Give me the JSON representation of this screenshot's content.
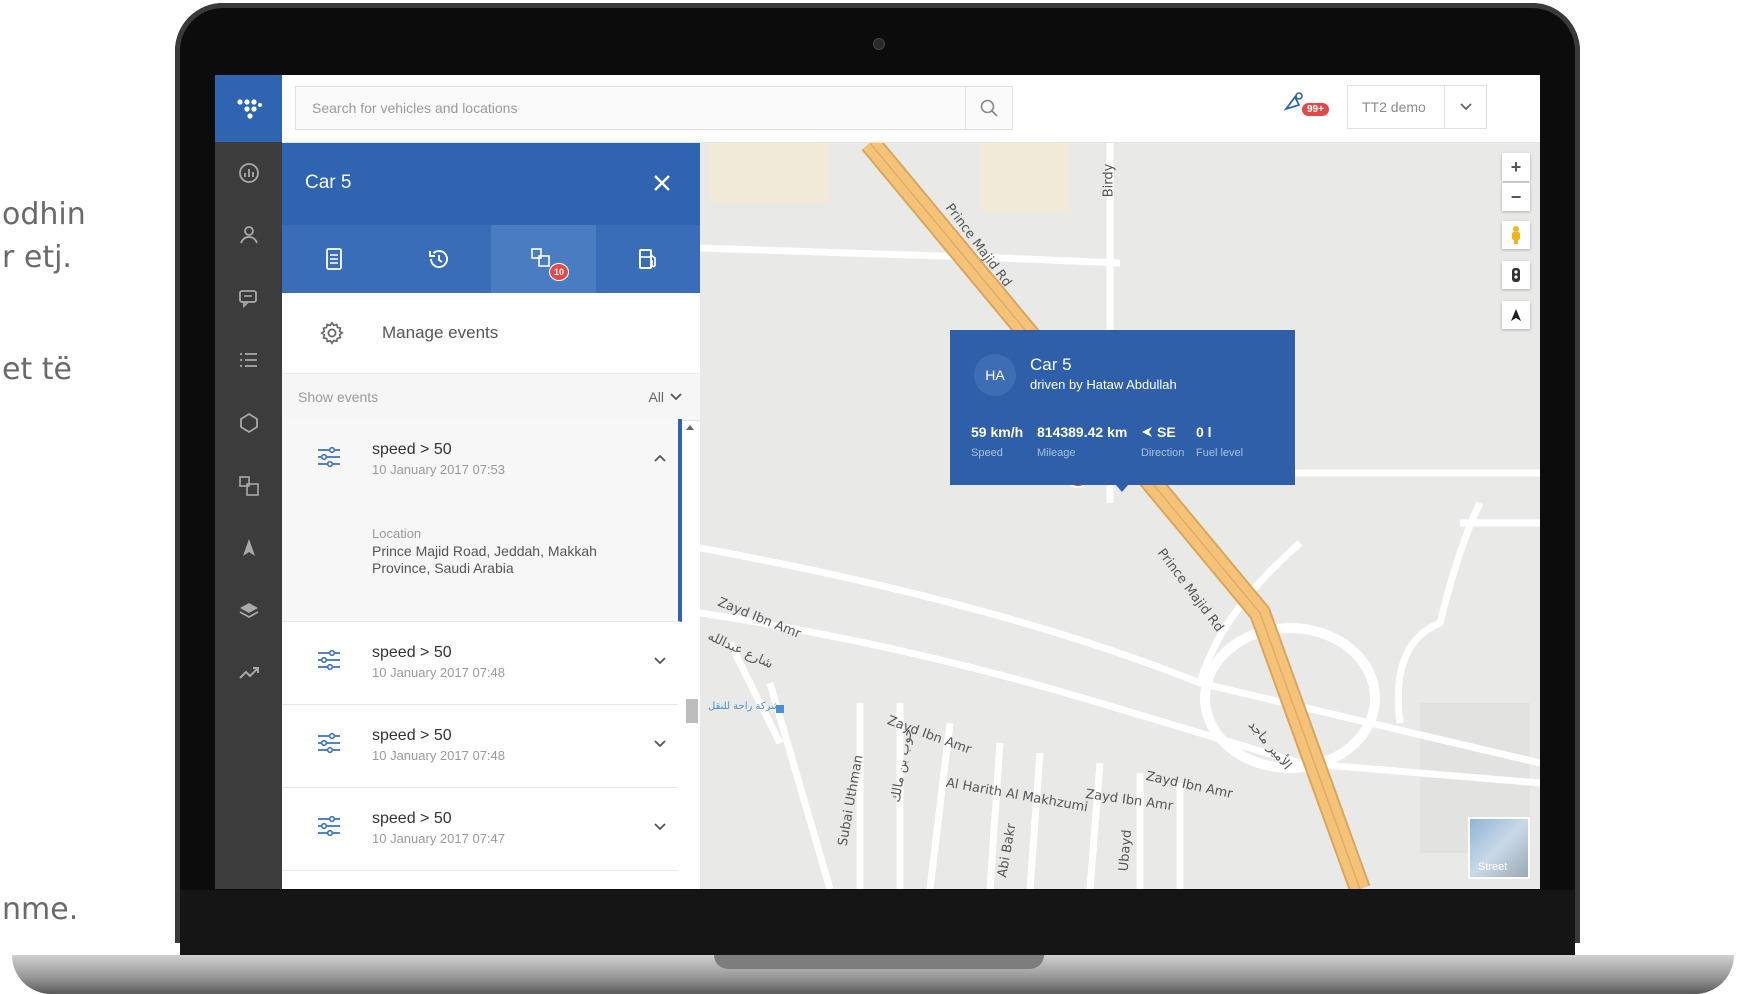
{
  "background_text": [
    "odhin",
    "r etj.",
    "et të",
    "nme."
  ],
  "topbar": {
    "search_placeholder": "Search for vehicles and locations",
    "notification_count": "99+",
    "account_label": "TT2 demo"
  },
  "rail": {
    "items": [
      "dashboard-icon",
      "user-icon",
      "messages-icon",
      "list-icon",
      "geofence-icon",
      "events-icon",
      "navigation-icon",
      "layers-icon",
      "reports-icon"
    ]
  },
  "panel": {
    "title": "Car 5",
    "tabs": [
      "details",
      "history",
      "events",
      "fuel"
    ],
    "events_tab_badge": "10",
    "manage_label": "Manage events",
    "filter_label": "Show events",
    "filter_value": "All",
    "events": [
      {
        "title": "speed > 50",
        "time": "10 January 2017 07:53",
        "location_label": "Location",
        "location": "Prince Majid Road, Jeddah, Makkah Province, Saudi Arabia",
        "expanded": true
      },
      {
        "title": "speed > 50",
        "time": "10 January 2017 07:48",
        "expanded": false
      },
      {
        "title": "speed > 50",
        "time": "10 January 2017 07:48",
        "expanded": false
      },
      {
        "title": "speed > 50",
        "time": "10 January 2017 07:47",
        "expanded": false
      }
    ]
  },
  "map": {
    "popup": {
      "initials": "HA",
      "name": "Car 5",
      "driver": "driven by Hataw Abdullah",
      "speed": "59 km/h",
      "speed_label": "Speed",
      "mileage": "814389.42 km",
      "mileage_label": "Mileage",
      "direction": "SE",
      "direction_label": "Direction",
      "fuel": "0 l",
      "fuel_label": "Fuel level"
    },
    "streets": {
      "prince_majid_1": "Prince Majid Rd",
      "prince_majid_2": "Prince Majid Rd",
      "birdy": "Birdy",
      "zayd_1": "Zayd Ibn Amr",
      "zayd_2": "Zayd Ibn Amr",
      "zayd_3": "Zayd Ibn Amr",
      "zayd_4": "Zayd Ibn Amr",
      "al_harith": "Al Harith Al Makhzumi",
      "subai": "Subai Uthman",
      "abi_bakr": "Abi Bakr",
      "ubayd": "Ubayd",
      "arabic_1": "شارع عبدالله",
      "arabic_2": "الأمير ماجد",
      "arabic_3": "جوب بن مالك",
      "poi": "شركة راحة للنقل"
    },
    "street_view_label": "Street",
    "controls": [
      "zoom-in",
      "zoom-out",
      "pegman",
      "traffic",
      "north"
    ]
  },
  "colors": {
    "brand": "#2f64b0",
    "rail": "#3c3c3c",
    "badge": "#e24a4a",
    "road": "#f5c27a"
  }
}
